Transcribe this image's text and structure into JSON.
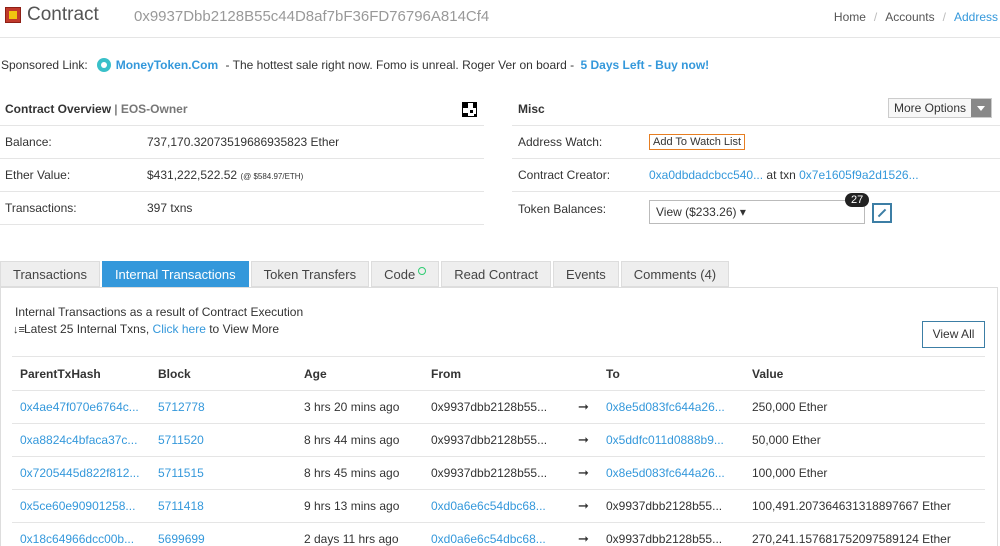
{
  "header": {
    "title": "Contract",
    "address": "0x9937Dbb2128B55c44D8af7bF36FD76796A814Cf4",
    "breadcrumb": [
      "Home",
      "Accounts",
      "Address"
    ]
  },
  "sponsored": {
    "label": "Sponsored Link:",
    "name": "MoneyToken.Com",
    "text": " - The hottest sale right now. Fomo is unreal. Roger Ver on board - ",
    "highlight": "5 Days Left - Buy now!"
  },
  "overview": {
    "title": "Contract Overview",
    "sep": " | ",
    "subtitle": "EOS-Owner",
    "balance_label": "Balance:",
    "balance_value": "737,170.32073519686935823 Ether",
    "ether_label": "Ether Value:",
    "ether_value": "$431,222,522.52",
    "ether_rate": "(@ $584.97/ETH)",
    "tx_label": "Transactions:",
    "tx_value": "397 txns"
  },
  "misc": {
    "title": "Misc",
    "more_options": "More Options",
    "watch_label": "Address Watch:",
    "watch_button": "Add To Watch List",
    "creator_label": "Contract Creator:",
    "creator_addr": "0xa0dbdadcbcc540...",
    "creator_at": " at txn ",
    "creator_txn": "0x7e1605f9a2d1526...",
    "token_label": "Token Balances:",
    "token_select": "View ($233.26) ▾",
    "token_badge": "27"
  },
  "tabs": [
    {
      "label": "Transactions",
      "active": false
    },
    {
      "label": "Internal Transactions",
      "active": true
    },
    {
      "label": "Token Transfers",
      "active": false
    },
    {
      "label": "Code",
      "active": false
    },
    {
      "label": "Read Contract",
      "active": false
    },
    {
      "label": "Events",
      "active": false
    },
    {
      "label": "Comments (4)",
      "active": false
    }
  ],
  "internal": {
    "title": "Internal Transactions as a result of Contract Execution",
    "latest": "Latest 25 Internal Txns, ",
    "click_here": "Click here",
    "view_more": " to View More",
    "view_all": "View All",
    "columns": [
      "ParentTxHash",
      "Block",
      "Age",
      "From",
      "",
      "To",
      "Value"
    ],
    "rows": [
      {
        "hash": "0x4ae47f070e6764c...",
        "block": "5712778",
        "age": "3 hrs 20 mins ago",
        "from": "0x9937dbb2128b55...",
        "from_link": false,
        "to": "0x8e5d083fc644a26...",
        "to_link": true,
        "value": "250,000 Ether"
      },
      {
        "hash": "0xa8824c4bfaca37c...",
        "block": "5711520",
        "age": "8 hrs 44 mins ago",
        "from": "0x9937dbb2128b55...",
        "from_link": false,
        "to": "0x5ddfc011d0888b9...",
        "to_link": true,
        "value": "50,000 Ether"
      },
      {
        "hash": "0x7205445d822f812...",
        "block": "5711515",
        "age": "8 hrs 45 mins ago",
        "from": "0x9937dbb2128b55...",
        "from_link": false,
        "to": "0x8e5d083fc644a26...",
        "to_link": true,
        "value": "100,000 Ether"
      },
      {
        "hash": "0x5ce60e90901258...",
        "block": "5711418",
        "age": "9 hrs 13 mins ago",
        "from": "0xd0a6e6c54dbc68...",
        "from_link": true,
        "to": "0x9937dbb2128b55...",
        "to_link": false,
        "value": "100,491.207364631318897667 Ether"
      },
      {
        "hash": "0x18c64966dcc00b...",
        "block": "5699699",
        "age": "2 days 11 hrs ago",
        "from": "0xd0a6e6c54dbc68...",
        "from_link": true,
        "to": "0x9937dbb2128b55...",
        "to_link": false,
        "value": "270,241.157681752097589124 Ether"
      }
    ]
  },
  "arrow": "➞"
}
